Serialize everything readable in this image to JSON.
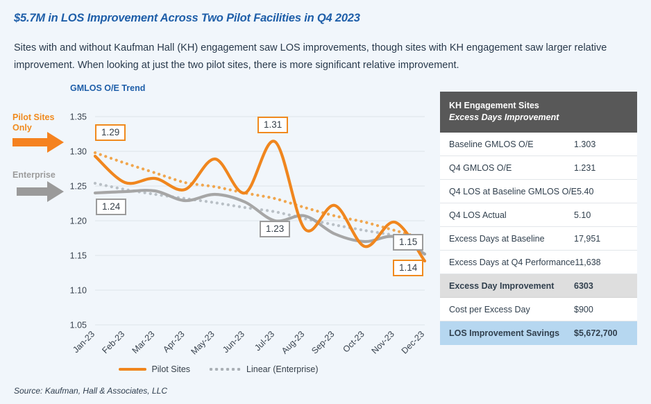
{
  "header": {
    "title": "$5.7M in LOS Improvement Across Two Pilot Facilities in Q4 2023",
    "subtitle": "Sites with and without Kaufman Hall (KH) engagement saw LOS improvements, though sites with KH engagement saw larger relative improvement. When looking at just the two pilot sites, there is more significant relative improvement."
  },
  "annotations": {
    "pilot_label": "Pilot Sites Only",
    "enterprise_label": "Enterprise",
    "pilot_arrow_icon": "right-arrow-icon",
    "enterprise_arrow_icon": "right-arrow-icon"
  },
  "callouts": {
    "pilot_start": "1.29",
    "pilot_peak": "1.31",
    "pilot_end": "1.14",
    "enterprise_start": "1.24",
    "enterprise_mid": "1.23",
    "enterprise_end": "1.15"
  },
  "source": "Source: Kaufman, Hall & Associates, LLC",
  "colors": {
    "accent_blue": "#1f5fa9",
    "pilot_orange": "#f0861e",
    "enterprise_grey": "#a6a6a6",
    "table_header": "#585858",
    "highlight_grey": "#dedede",
    "highlight_blue": "#b6d7f0",
    "page_background": "#f1f6fb"
  },
  "chart_data": {
    "type": "line",
    "title": "GMLOS O/E Trend",
    "xlabel": "",
    "ylabel": "",
    "ylim": [
      1.05,
      1.35
    ],
    "yticks": [
      "1.05",
      "1.10",
      "1.15",
      "1.20",
      "1.25",
      "1.30",
      "1.35"
    ],
    "grid": true,
    "legend_position": "bottom",
    "categories": [
      "Jan-23",
      "Feb-23",
      "Mar-23",
      "Apr-23",
      "May-23",
      "Jun-23",
      "Jul-23",
      "Aug-23",
      "Sep-23",
      "Oct-23",
      "Nov-23",
      "Dec-23"
    ],
    "series": [
      {
        "name": "Pilot Sites",
        "style": "solid",
        "color": "#f0861e",
        "values": [
          1.293,
          1.255,
          1.261,
          1.245,
          1.289,
          1.24,
          1.314,
          1.188,
          1.222,
          1.163,
          1.198,
          1.142
        ]
      },
      {
        "name": "Enterprise",
        "style": "solid",
        "color": "#a6a6a6",
        "values": [
          1.24,
          1.242,
          1.243,
          1.229,
          1.238,
          1.227,
          1.2,
          1.207,
          1.181,
          1.17,
          1.177,
          1.152
        ]
      },
      {
        "name": "Linear (Pilot Sites)",
        "style": "dotted",
        "color": "#f0a64e",
        "values": [
          1.298,
          1.283,
          1.269,
          1.255,
          1.249,
          1.24,
          1.232,
          1.219,
          1.207,
          1.198,
          1.186,
          1.174
        ]
      },
      {
        "name": "Linear (Enterprise)",
        "style": "dotted",
        "color": "#b9c0c6",
        "values": [
          1.254,
          1.245,
          1.238,
          1.232,
          1.226,
          1.219,
          1.213,
          1.203,
          1.194,
          1.186,
          1.179,
          1.17
        ]
      }
    ],
    "legend": [
      {
        "label": "Pilot Sites",
        "style": "solid",
        "color": "#f0861e"
      },
      {
        "label": "Linear (Enterprise)",
        "style": "dotted",
        "color": "#aab0b6"
      }
    ]
  },
  "table": {
    "header_line1": "KH Engagement Sites",
    "header_line2": "Excess Days Improvement",
    "rows": [
      {
        "label": "Baseline GMLOS O/E",
        "value": "1.303",
        "style": "plain"
      },
      {
        "label": "Q4 GMLOS O/E",
        "value": "1.231",
        "style": "plain"
      },
      {
        "label": "Q4 LOS at Baseline GMLOS O/E",
        "value": "5.40",
        "style": "plain"
      },
      {
        "label": "Q4 LOS Actual",
        "value": "5.10",
        "style": "plain"
      },
      {
        "label": "Excess Days at Baseline",
        "value": "17,951",
        "style": "plain"
      },
      {
        "label": "Excess Days at Q4 Performance",
        "value": "11,638",
        "style": "plain"
      },
      {
        "label": "Excess Day Improvement",
        "value": "6303",
        "style": "grey"
      },
      {
        "label": "Cost per Excess Day",
        "value": "$900",
        "style": "plain"
      },
      {
        "label": "LOS Improvement Savings",
        "value": "$5,672,700",
        "style": "blue"
      }
    ]
  }
}
